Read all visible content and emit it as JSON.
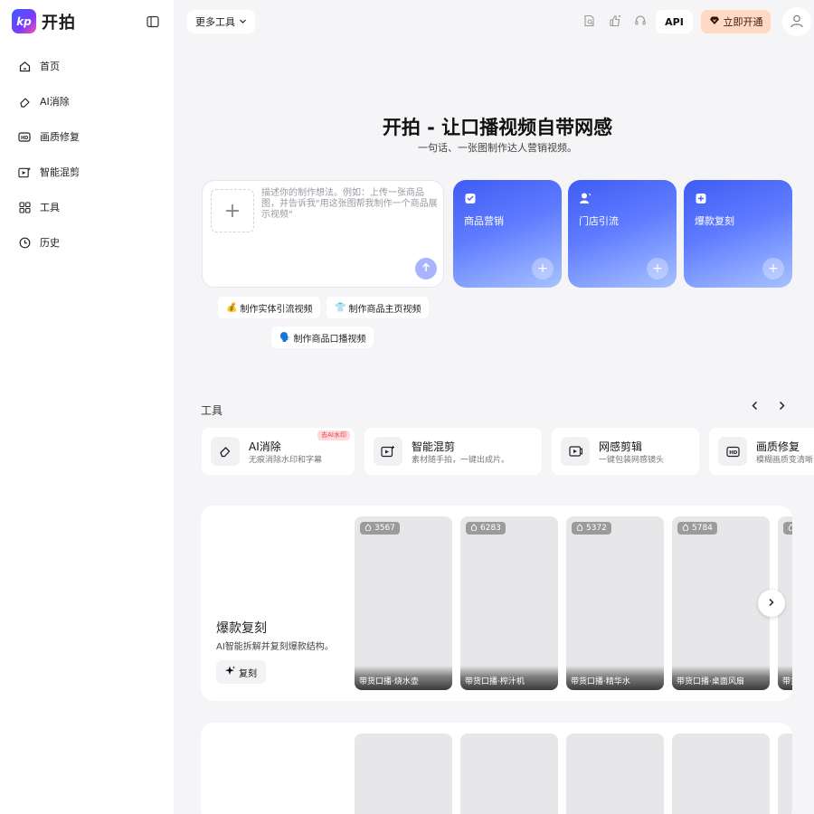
{
  "brand": {
    "name": "开拍",
    "mark": "kp"
  },
  "sidebar": {
    "items": [
      {
        "label": "首页",
        "icon": "home-icon"
      },
      {
        "label": "AI消除",
        "icon": "eraser-icon"
      },
      {
        "label": "画质修复",
        "icon": "hd-icon"
      },
      {
        "label": "智能混剪",
        "icon": "smart-clip-icon"
      },
      {
        "label": "工具",
        "icon": "grid-icon"
      },
      {
        "label": "历史",
        "icon": "clock-icon"
      }
    ]
  },
  "topbar": {
    "more_tools": "更多工具",
    "api": "API",
    "vip": "立即开通"
  },
  "hero": {
    "title": "开拍 - 让口播视频自带网感",
    "subtitle": "一句话、一张图制作达人营销视频。",
    "placeholder": "描述你的制作想法。例如：上传一张商品图，并告诉我\"用这张图帮我制作一个商品展示视频\""
  },
  "feature_cards": [
    {
      "label": "商品营销",
      "icon": "product-icon"
    },
    {
      "label": "门店引流",
      "icon": "store-icon"
    },
    {
      "label": "爆款复刻",
      "icon": "copy-icon"
    }
  ],
  "suggestions": [
    {
      "emoji": "💰",
      "label": "制作实体引流视频"
    },
    {
      "emoji": "👕",
      "label": "制作商品主页视频"
    },
    {
      "emoji": "🗣️",
      "label": "制作商品口播视频"
    }
  ],
  "tools": {
    "title": "工具",
    "items": [
      {
        "name": "AI消除",
        "desc": "无痕消除水印和字幕",
        "badge": "去AI水印"
      },
      {
        "name": "智能混剪",
        "desc": "素材随手拍，一键出成片。",
        "badge": ""
      },
      {
        "name": "网感剪辑",
        "desc": "一键包装网感镜头",
        "badge": ""
      },
      {
        "name": "画质修复",
        "desc": "模糊画质变清晰",
        "badge": ""
      }
    ]
  },
  "showcase": {
    "title": "爆款复刻",
    "desc": "AI智能拆解并复刻爆款结构。",
    "button": "复刻",
    "videos": [
      {
        "count": "3567",
        "title": "带货口播·烧水壶"
      },
      {
        "count": "6283",
        "title": "带货口播·榨汁机"
      },
      {
        "count": "5372",
        "title": "带货口播·精华水"
      },
      {
        "count": "5784",
        "title": "带货口播·桌面风扇"
      },
      {
        "count": "",
        "title": "带货"
      }
    ]
  },
  "colors": {
    "accent": "#4a63f7",
    "vip_bg": "#ffd9c4",
    "page_bg": "#f5f5f7"
  }
}
